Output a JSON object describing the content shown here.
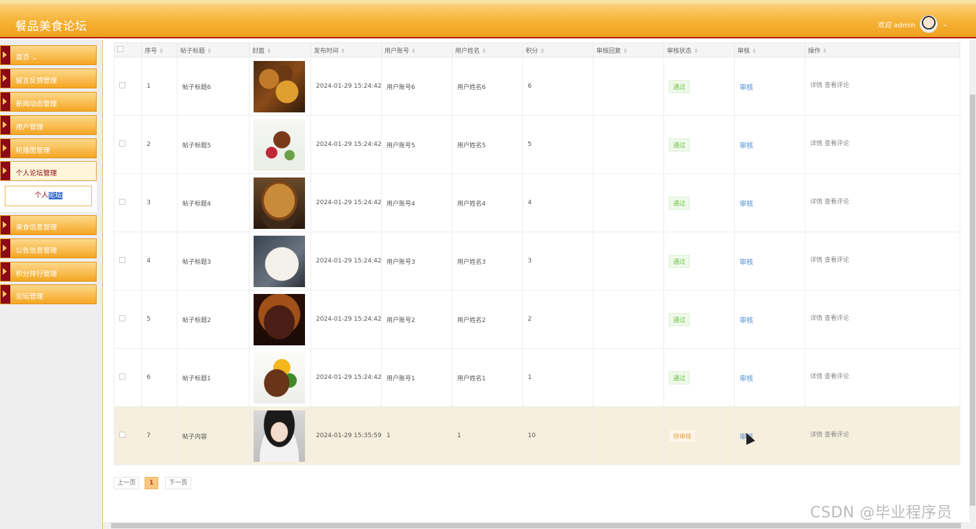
{
  "header": {
    "title": "餐品美食论坛",
    "welcome": "欢迎 admin"
  },
  "sidebar": {
    "items": [
      {
        "label": "首页 ⌄"
      },
      {
        "label": "留言反馈管理"
      },
      {
        "label": "新闻动态管理"
      },
      {
        "label": "用户管理"
      },
      {
        "label": "轮播图管理"
      },
      {
        "label": "个人论坛管理"
      },
      {
        "label": "美食信息管理"
      },
      {
        "label": "公告信息管理"
      },
      {
        "label": "积分排行管理"
      },
      {
        "label": "论坛管理"
      }
    ],
    "submenu": {
      "label_a": "个人",
      "label_b": "论坛"
    }
  },
  "table": {
    "headers": {
      "index": "序号",
      "title": "帖子标题",
      "cover": "封面",
      "time": "发布时间",
      "account": "用户账号",
      "name": "用户姓名",
      "points": "积分",
      "reply": "审核回复",
      "status": "审核状态",
      "audit": "审核",
      "ops": "操作"
    },
    "rows": [
      {
        "index": "1",
        "title": "帖子标题6",
        "time": "2024-01-29 15:24:42",
        "account": "用户账号6",
        "name": "用户姓名6",
        "points": "6",
        "reply": "",
        "status": "通过",
        "audit": "审核",
        "detail": "详情",
        "comment": "查看评论"
      },
      {
        "index": "2",
        "title": "帖子标题5",
        "time": "2024-01-29 15:24:42",
        "account": "用户账号5",
        "name": "用户姓名5",
        "points": "5",
        "reply": "",
        "status": "通过",
        "audit": "审核",
        "detail": "详情",
        "comment": "查看评论"
      },
      {
        "index": "3",
        "title": "帖子标题4",
        "time": "2024-01-29 15:24:42",
        "account": "用户账号4",
        "name": "用户姓名4",
        "points": "4",
        "reply": "",
        "status": "通过",
        "audit": "审核",
        "detail": "详情",
        "comment": "查看评论"
      },
      {
        "index": "4",
        "title": "帖子标题3",
        "time": "2024-01-29 15:24:42",
        "account": "用户账号3",
        "name": "用户姓名3",
        "points": "3",
        "reply": "",
        "status": "通过",
        "audit": "审核",
        "detail": "详情",
        "comment": "查看评论"
      },
      {
        "index": "5",
        "title": "帖子标题2",
        "time": "2024-01-29 15:24:42",
        "account": "用户账号2",
        "name": "用户姓名2",
        "points": "2",
        "reply": "",
        "status": "通过",
        "audit": "审核",
        "detail": "详情",
        "comment": "查看评论"
      },
      {
        "index": "6",
        "title": "帖子标题1",
        "time": "2024-01-29 15:24:42",
        "account": "用户账号1",
        "name": "用户姓名1",
        "points": "1",
        "reply": "",
        "status": "通过",
        "audit": "审核",
        "detail": "详情",
        "comment": "查看评论"
      },
      {
        "index": "7",
        "title": "帖子内容",
        "time": "2024-01-29 15:35:59",
        "account": "1",
        "name": "1",
        "points": "10",
        "reply": "",
        "status": "待审核",
        "audit": "审核",
        "detail": "详情",
        "comment": "查看评论"
      }
    ]
  },
  "pager": {
    "prev": "上一页",
    "current": "1",
    "next": "下一页"
  },
  "watermark": "CSDN @毕业程序员",
  "colors": {
    "accent": "#f5a623",
    "brand_dark": "#8b0a16",
    "pass": "#67c23a",
    "pending": "#e6a23c",
    "link": "#4a8fd8"
  },
  "icons": {
    "sort": "sort-arrows-icon",
    "avatar": "user-avatar-icon",
    "menu_arrow": "triangle-right-icon"
  }
}
